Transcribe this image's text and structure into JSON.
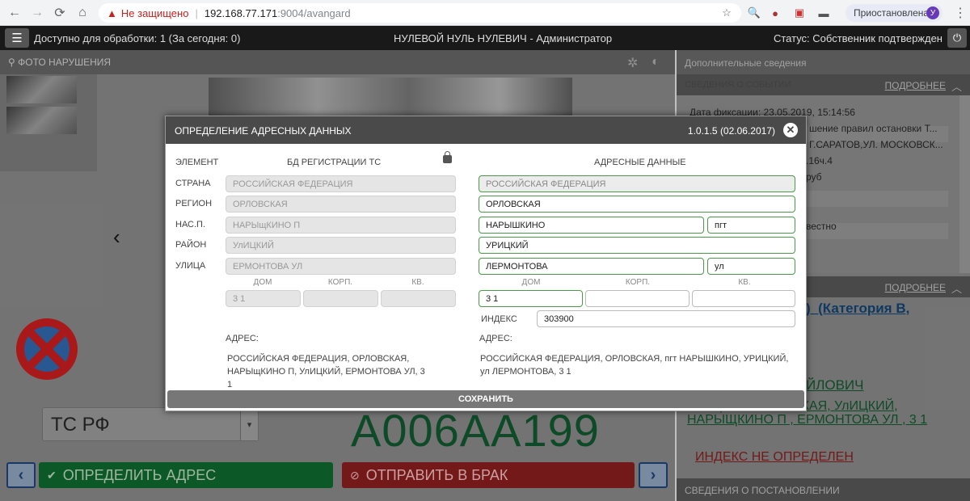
{
  "browser": {
    "insecure_label": "Не защищено",
    "url_host": "192.168.77.171",
    "url_path": ":9004/avangard",
    "paused_label": "Приостановлена",
    "avatar_letter": "У"
  },
  "header": {
    "available": "Доступно для обработки: 1 (За сегодня: 0)",
    "user": "НУЛЕВОЙ НУЛЬ НУЛЕВИЧ - Администратор",
    "status": "Статус: Собственник подтвержден"
  },
  "left": {
    "photo_title": "ФОТО НАРУШЕНИЯ",
    "ts_select": "ТС РФ",
    "plate": "А006АА199",
    "btn_define": "ОПРЕДЕЛИТЬ АДРЕС",
    "btn_reject": "ОТПРАВИТЬ В БРАК"
  },
  "right": {
    "extra_title": "Дополнительные сведения",
    "event_title": "СВЕДЕНИЯ О СОБЫТИИ",
    "more": "ПОДРОБНЕЕ",
    "event_lines": [
      "Дата фиксации:    23.05.2019, 15:14:56",
      "шение правил остановки Т...",
      "Г.САРАТОВ,УЛ. МОСКОВСК...",
      ".16ч.4",
      "руб",
      "вестно"
    ],
    "owner_title": ")_(Категория В,",
    "owner_name": "ЙЛОВИЧ",
    "owner_addr": "ЕРАЦИЯ, ОРЛОВСКАЯ, УлИЦКИЙ, НАРЫЩКИНО П , ЕРМОНТОВА УЛ , 3 1",
    "index_undefined": "ИНДЕКС НЕ ОПРЕДЕЛЕН",
    "post_title": "СВЕДЕНИЯ О ПОСТАНОВЛЕНИИ"
  },
  "modal": {
    "title": "ОПРЕДЕЛЕНИЕ АДРЕСНЫХ ДАННЫХ",
    "version": "1.0.1.5 (02.06.2017)",
    "col_element": "ЭЛЕМЕНТ",
    "col_db": "БД РЕГИСТРАЦИИ ТС",
    "col_addr": "АДРЕСНЫЕ ДАННЫЕ",
    "labels": {
      "country": "СТРАНА",
      "region": "РЕГИОН",
      "locality": "НАС.П.",
      "district": "РАЙОН",
      "street": "УЛИЦА",
      "house": "ДОМ",
      "building": "КОРП.",
      "flat": "КВ.",
      "index": "ИНДЕКС",
      "address": "АДРЕС:"
    },
    "db": {
      "country": "РОССИЙСКАЯ ФЕДЕРАЦИЯ",
      "region": "ОРЛОВСКАЯ",
      "locality": "НАРЫщКИНО П",
      "district": "УлИЦКИЙ",
      "street": "ЕРМОНТОВА УЛ",
      "house": "3 1",
      "building": "",
      "flat": "",
      "address": "РОССИЙСКАЯ ФЕДЕРАЦИЯ, ОРЛОВСКАЯ, НАРЫщКИНО П, УлИЦКИЙ, ЕРМОНТОВА УЛ, 3 1"
    },
    "addr": {
      "country": "РОССИЙСКАЯ ФЕДЕРАЦИЯ",
      "region": "ОРЛОВСКАЯ",
      "locality": "НАРЫШКИНО",
      "locality_type": "пгт",
      "district": "УРИЦКИЙ",
      "street": "ЛЕРМОНТОВА",
      "street_type": "ул",
      "house": "3 1",
      "building": "",
      "flat": "",
      "index": "303900",
      "address": "РОССИЙСКАЯ ФЕДЕРАЦИЯ, ОРЛОВСКАЯ, пгт НАРЫШКИНО, УРИЦКИЙ, ул ЛЕРМОНТОВА, 3 1"
    },
    "save": "СОХРАНИТЬ"
  }
}
